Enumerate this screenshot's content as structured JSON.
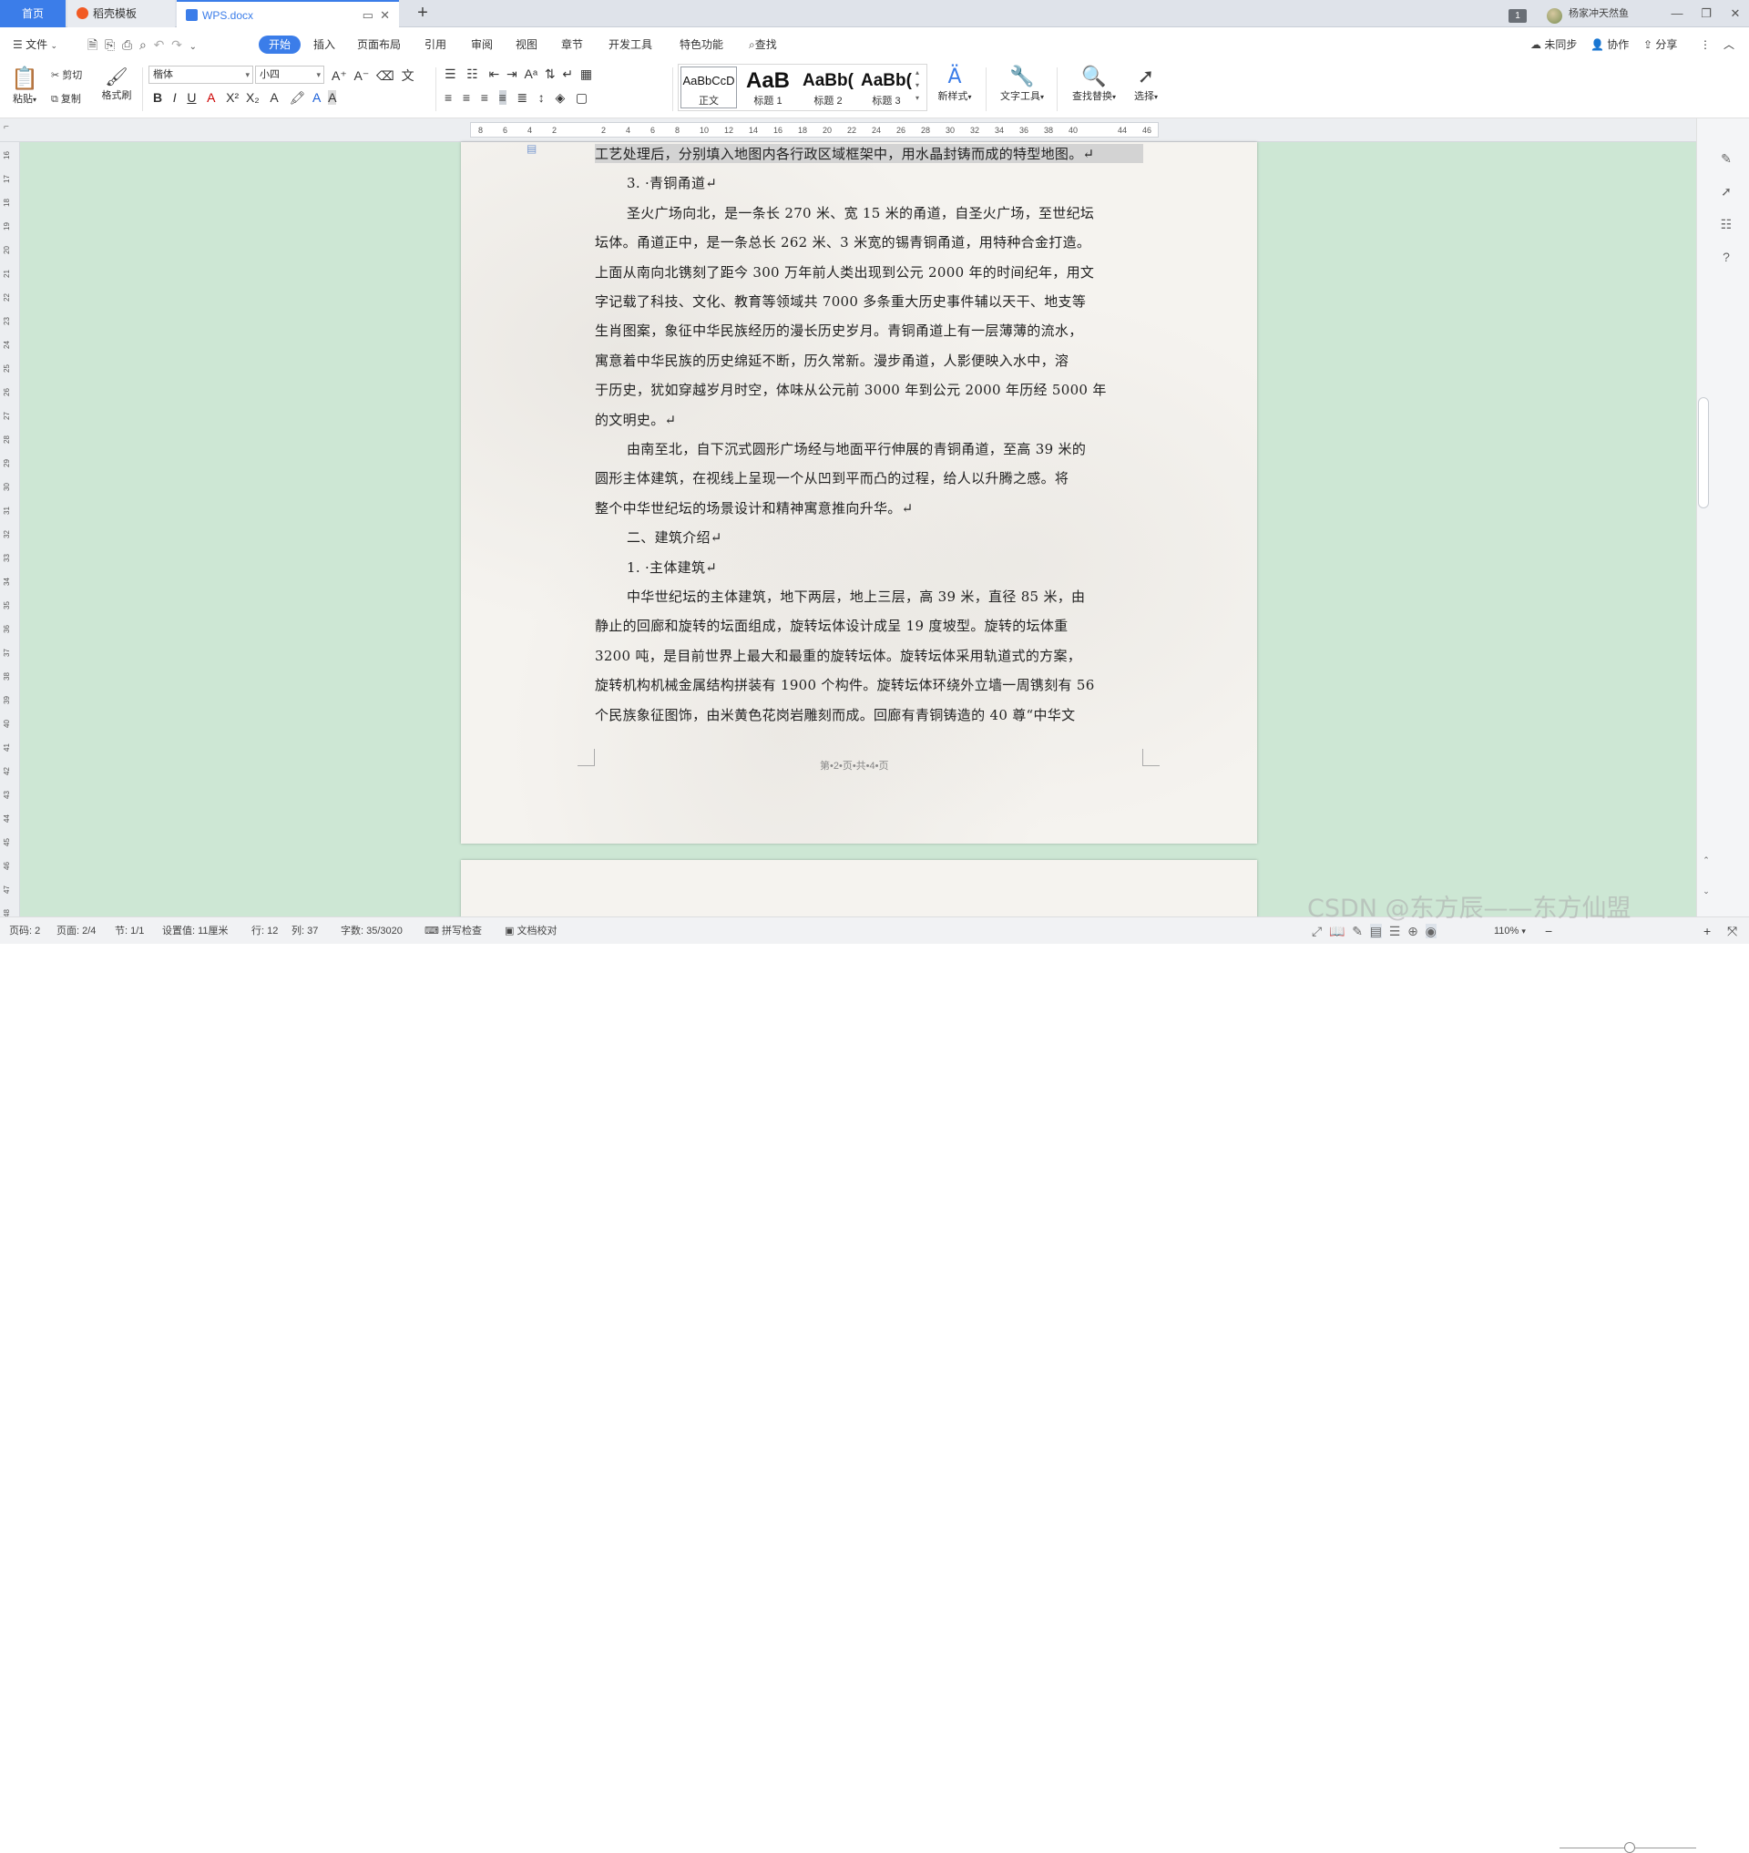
{
  "titlebar": {
    "tab_home": "首页",
    "tab_template": "稻壳模板",
    "tab_doc": "WPS.docx",
    "add_tab": "+",
    "badge": "1",
    "username": "杨家冲天然鱼"
  },
  "menu": {
    "file": "文件",
    "start": "开始",
    "insert": "插入",
    "layout": "页面布局",
    "reference": "引用",
    "review": "审阅",
    "view": "视图",
    "chapter": "章节",
    "devtools": "开发工具",
    "special": "特色功能",
    "search": "查找",
    "sync": "未同步",
    "collab": "协作",
    "share": "分享"
  },
  "ribbon": {
    "paste": "粘贴",
    "cut": "剪切",
    "copy": "复制",
    "format_painter": "格式刷",
    "font_name": "楷体",
    "font_size": "小四",
    "styles": [
      {
        "sample": "AaBbCcD",
        "label": "正文"
      },
      {
        "sample": "AaB",
        "label": "标题 1"
      },
      {
        "sample": "AaBb(",
        "label": "标题 2"
      },
      {
        "sample": "AaBb(",
        "label": "标题 3"
      }
    ],
    "new_style": "新样式",
    "text_tools": "文字工具",
    "find_replace": "查找替换",
    "select": "选择"
  },
  "ruler": {
    "ticks": [
      "8",
      "6",
      "4",
      "2",
      "",
      "2",
      "4",
      "6",
      "8",
      "10",
      "12",
      "14",
      "16",
      "18",
      "20",
      "22",
      "24",
      "26",
      "28",
      "30",
      "32",
      "34",
      "36",
      "38",
      "40",
      "",
      "44",
      "46"
    ],
    "vticks": [
      "16",
      "17",
      "18",
      "19",
      "20",
      "21",
      "22",
      "23",
      "24",
      "25",
      "26",
      "27",
      "28",
      "29",
      "30",
      "31",
      "32",
      "33",
      "34",
      "35",
      "36",
      "37",
      "38",
      "39",
      "40",
      "41",
      "42",
      "43",
      "44",
      "45",
      "46",
      "47",
      "48"
    ]
  },
  "document": {
    "lines": [
      "工艺处理后，分别填入地图内各行政区域框架中，用水晶封铸而成的特型地图。↵",
      "3. ·青铜甬道↵",
      "圣火广场向北，是一条长 270 米、宽 15 米的甬道，自圣火广场，至世纪坛",
      "坛体。甬道正中，是一条总长 262 米、3 米宽的锡青铜甬道，用特种合金打造。",
      "上面从南向北镌刻了距今 300 万年前人类出现到公元 2000 年的时间纪年，用文",
      "字记载了科技、文化、教育等领域共 7000 多条重大历史事件辅以天干、地支等",
      "生肖图案，象征中华民族经历的漫长历史岁月。青铜甬道上有一层薄薄的流水，",
      "寓意着中华民族的历史绵延不断，历久常新。漫步甬道，人影便映入水中，溶",
      "于历史，犹如穿越岁月时空，体味从公元前 3000 年到公元 2000 年历经 5000 年",
      "的文明史。↵",
      "由南至北，自下沉式圆形广场经与地面平行伸展的青铜甬道，至高 39 米的",
      "圆形主体建筑，在视线上呈现一个从凹到平而凸的过程，给人以升腾之感。将",
      "整个中华世纪坛的场景设计和精神寓意推向升华。↵",
      "二、建筑介绍↵",
      "1. ·主体建筑↵",
      "中华世纪坛的主体建筑，地下两层，地上三层，高 39 米，直径 85 米，由",
      "静止的回廊和旋转的坛面组成，旋转坛体设计成呈 19 度坡型。旋转的坛体重",
      "3200 吨，是目前世界上最大和最重的旋转坛体。旋转坛体采用轨道式的方案，",
      "旋转机构机械金属结构拼装有 1900 个构件。旋转坛体环绕外立墙一周镌刻有 56",
      "个民族象征图饰，由米黄色花岗岩雕刻而成。回廊有青铜铸造的 40 尊“中华文"
    ],
    "footer": "第•2•页•共•4•页"
  },
  "statusbar": {
    "page_code": "页码: 2",
    "page": "页面: 2/4",
    "section": "节: 1/1",
    "setting": "设置值: 11厘米",
    "row": "行: 12",
    "col": "列: 37",
    "word_count": "字数: 35/3020",
    "spell_check": "拼写检查",
    "doc_proof": "文档校对",
    "zoom": "110%"
  },
  "watermark": "CSDN @东方辰——东方仙盟"
}
